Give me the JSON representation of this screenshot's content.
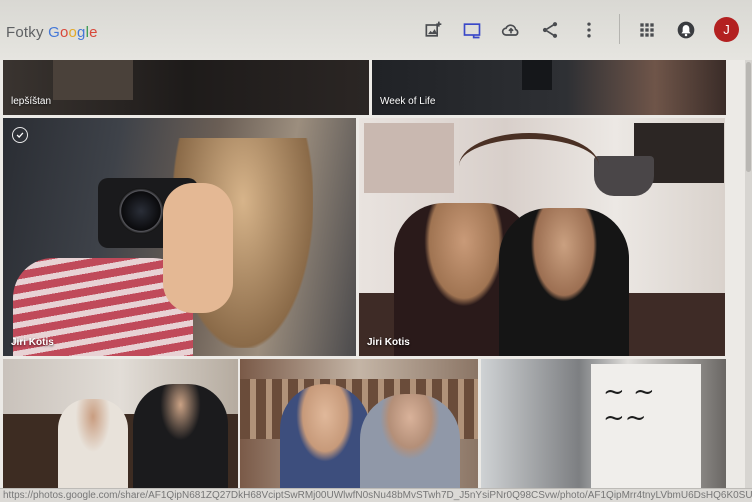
{
  "header": {
    "brand_prefix": "Fotky",
    "brand_google": [
      "G",
      "o",
      "o",
      "g",
      "l",
      "e"
    ],
    "avatar_letter": "J",
    "icons": [
      "add-photo-icon",
      "slideshow-icon",
      "upload-icon",
      "share-icon",
      "more-vert-icon",
      "apps-grid-icon",
      "notifications-icon"
    ]
  },
  "tiles": {
    "top_left_caption": "lepšíštan",
    "top_right_caption": "Week of Life",
    "big_left_caption": "Jiri Kotis",
    "big_right_caption": "Jiri Kotis"
  },
  "status_url": "https://photos.google.com/share/AF1QipN681ZQ27DkH68VciptSwRMj00UWlwfN0sNu48bMvSTwh7D_J5nYsiPNr0Q98CSvw/photo/AF1QipMrr4tnyLVbmU6DsHQ6K0SUR"
}
